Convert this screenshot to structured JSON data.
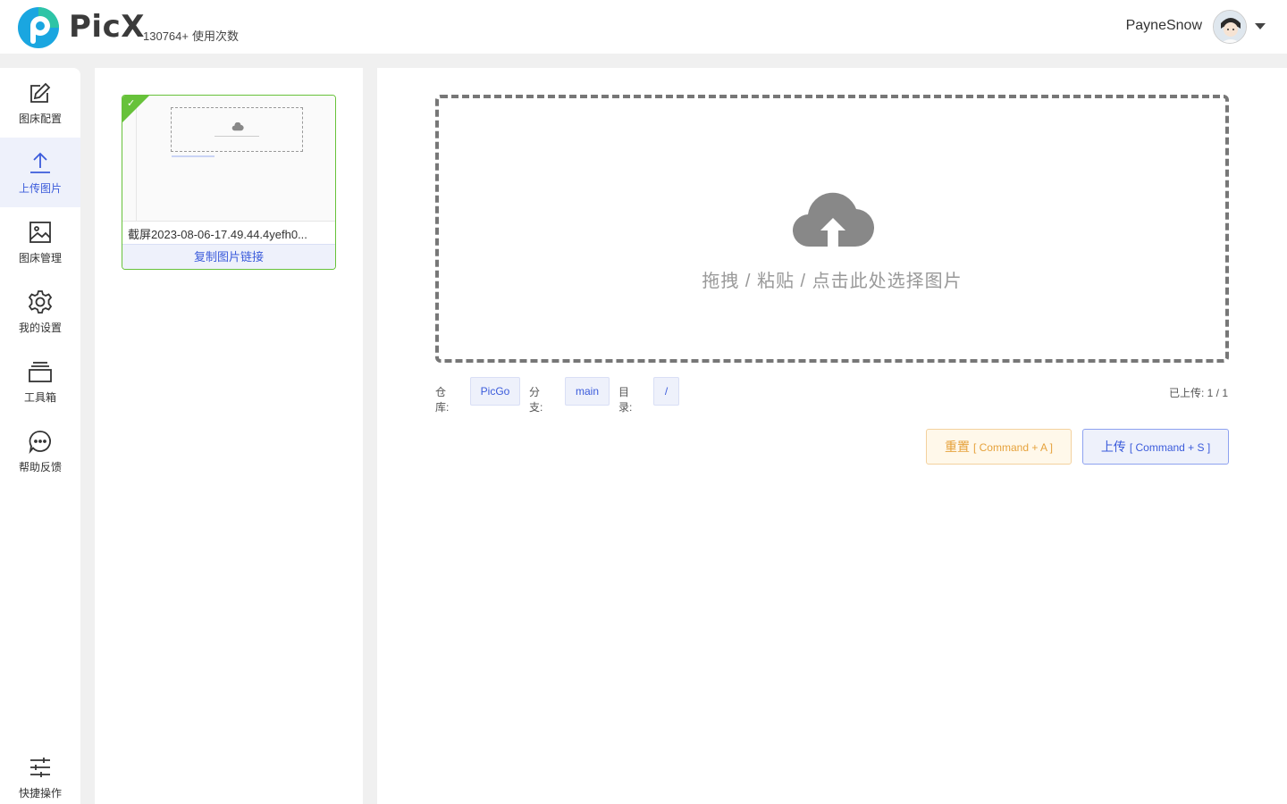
{
  "app": {
    "name": "PicX",
    "usage_count": "130764+",
    "usage_label": "使用次数"
  },
  "user": {
    "name": "PayneSnow"
  },
  "sidebar": {
    "items": [
      {
        "label": "图床配置",
        "icon": "edit-icon"
      },
      {
        "label": "上传图片",
        "icon": "upload-icon",
        "active": true
      },
      {
        "label": "图床管理",
        "icon": "image-icon"
      },
      {
        "label": "我的设置",
        "icon": "gear-icon"
      },
      {
        "label": "工具箱",
        "icon": "toolbox-icon"
      },
      {
        "label": "帮助反馈",
        "icon": "chat-icon"
      }
    ],
    "quick": {
      "label": "快捷操作",
      "icon": "sliders-icon"
    }
  },
  "upload_list": {
    "items": [
      {
        "file_name": "截屏2023-08-06-17.49.44.4yefh0...",
        "copy_label": "复制图片链接",
        "status": "success"
      }
    ]
  },
  "drop_zone": {
    "text": "拖拽 / 粘贴 / 点击此处选择图片"
  },
  "meta": {
    "repo_label": "仓库:",
    "repo": "PicGo",
    "branch_label": "分支:",
    "branch": "main",
    "dir_label": "目录:",
    "dir": "/",
    "uploaded_label": "已上传:",
    "uploaded": "1 / 1"
  },
  "actions": {
    "reset_label": "重置",
    "reset_shortcut": "[ Command + A ]",
    "upload_label": "上传",
    "upload_shortcut": "[ Command + S ]"
  },
  "colors": {
    "accent": "#3b5bdb",
    "success": "#67c23a",
    "warning": "#e6a23c"
  }
}
